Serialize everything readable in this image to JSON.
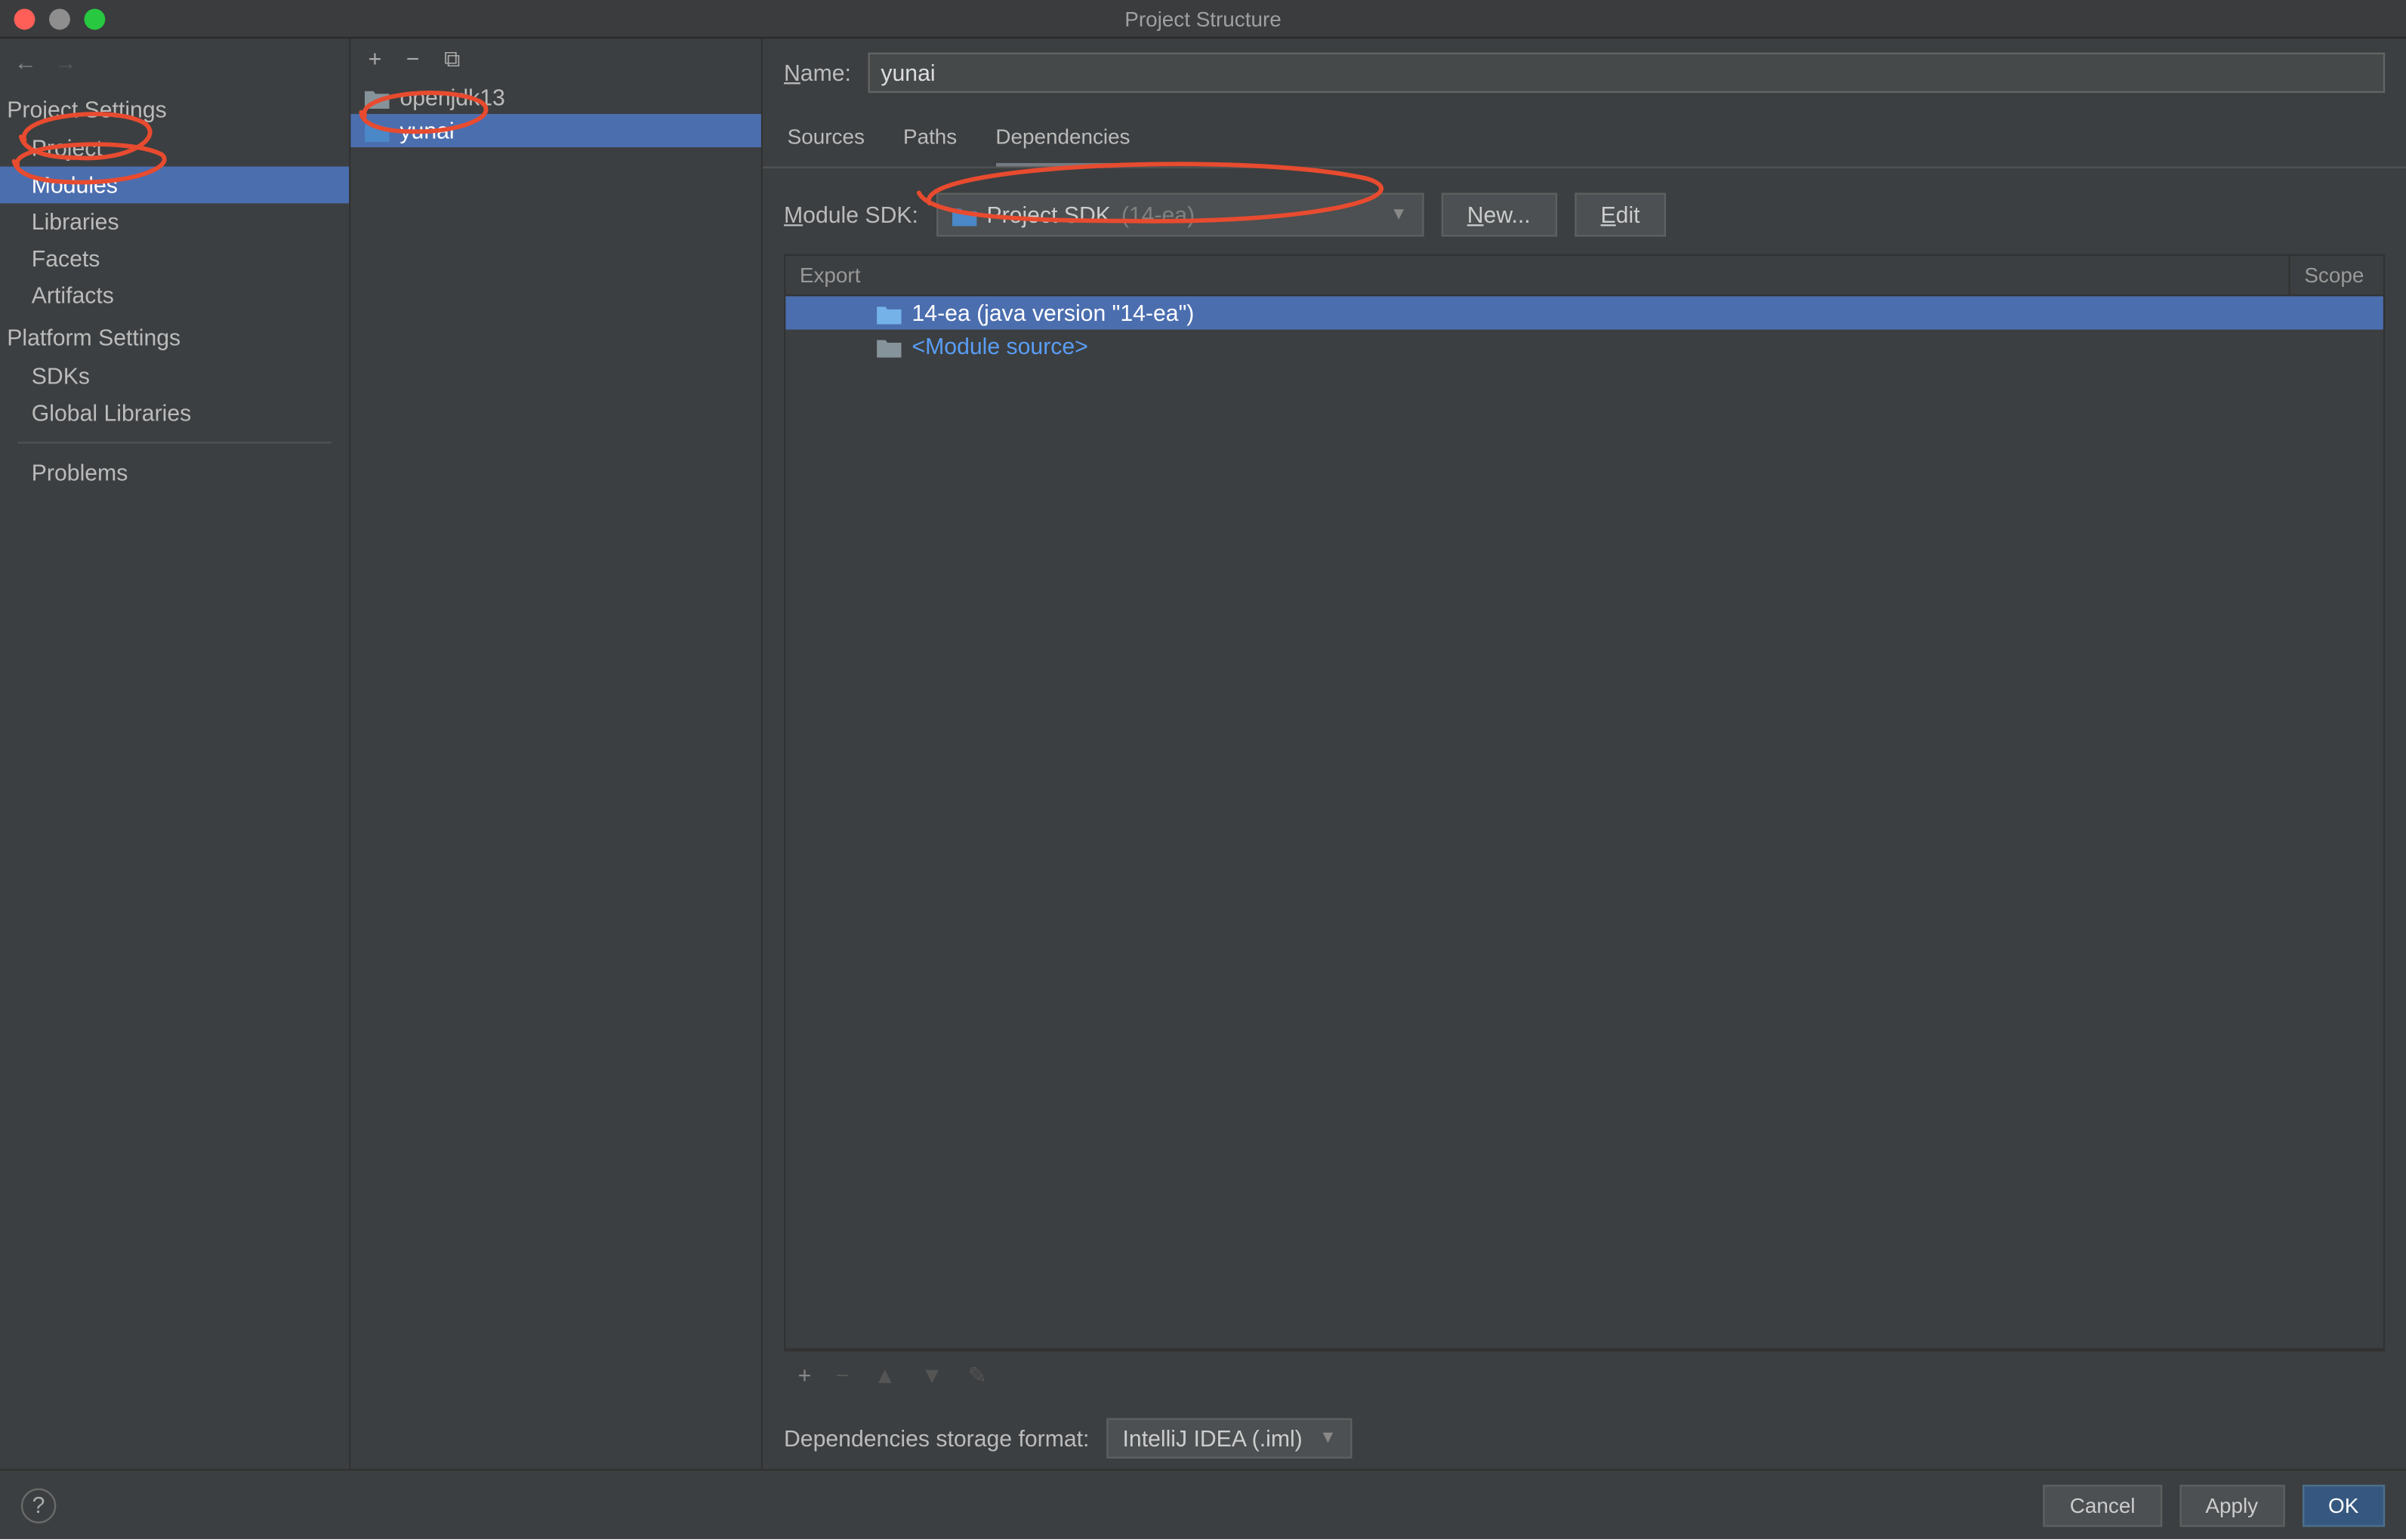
{
  "title": "Project Structure",
  "sidebar": {
    "project_settings_header": "Project Settings",
    "platform_settings_header": "Platform Settings",
    "items": {
      "project": "Project",
      "modules": "Modules",
      "libraries": "Libraries",
      "facets": "Facets",
      "artifacts": "Artifacts",
      "sdks": "SDKs",
      "global_libraries": "Global Libraries",
      "problems": "Problems"
    }
  },
  "modules": {
    "list": [
      {
        "name": "openjdk13",
        "selected": false
      },
      {
        "name": "yunai",
        "selected": true
      }
    ]
  },
  "main": {
    "name_label_prefix": "N",
    "name_label_suffix": "ame:",
    "name_value": "yunai",
    "tabs": {
      "sources": "Sources",
      "paths": "Paths",
      "dependencies": "Dependencies"
    },
    "sdk": {
      "label_prefix": "M",
      "label_suffix": "odule SDK:",
      "value": "Project SDK",
      "hint": "(14-ea)",
      "new_prefix": "N",
      "new_suffix": "ew...",
      "edit_prefix": "E",
      "edit_suffix": "dit"
    },
    "table": {
      "header_export": "Export",
      "header_scope": "Scope",
      "rows": [
        {
          "label": "14-ea (java version \"14-ea\")",
          "kind": "sdk",
          "selected": true
        },
        {
          "label": "<Module source>",
          "kind": "source",
          "selected": false
        }
      ]
    },
    "storage": {
      "label": "Dependencies storage format:",
      "value": "IntelliJ IDEA (.iml)"
    }
  },
  "footer": {
    "cancel": "Cancel",
    "apply": "Apply",
    "ok": "OK",
    "help": "?"
  }
}
